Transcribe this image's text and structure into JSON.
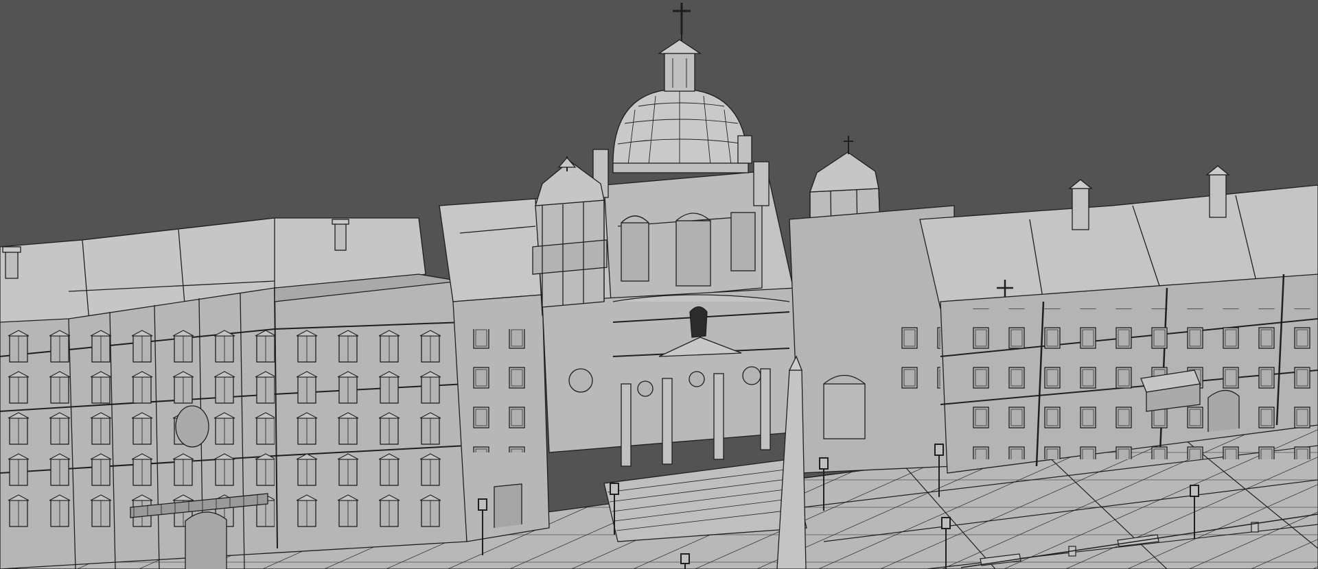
{
  "viewport": {
    "background_color": "#535353",
    "model_fill_color": "#b9b9b9",
    "model_shadow_color": "#8d8d8d",
    "wire_color": "#1e1e1e"
  },
  "scene": {
    "subject": "wireframe-church-square-model",
    "icons": [
      "cross-icon",
      "dome",
      "bell-tower",
      "clock-icon",
      "street-lamp",
      "bench",
      "obelisk"
    ]
  }
}
